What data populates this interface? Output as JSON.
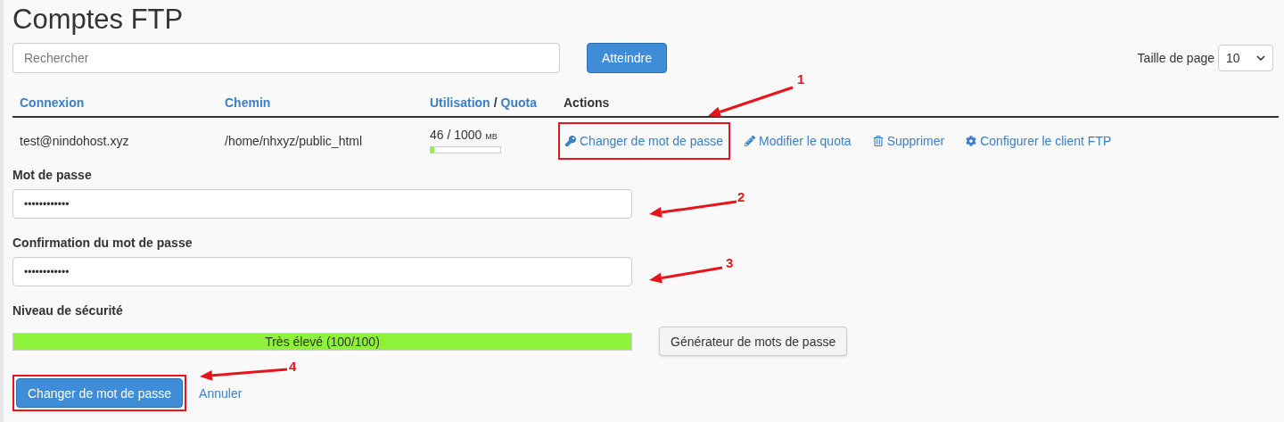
{
  "title": "Comptes FTP",
  "search": {
    "placeholder": "Rechercher"
  },
  "go_button": "Atteindre",
  "page_size": {
    "label": "Taille de page",
    "value": "10"
  },
  "table": {
    "headers": [
      {
        "kind": "link",
        "label": "Connexion"
      },
      {
        "kind": "link",
        "label": "Chemin"
      },
      {
        "kind": "pair",
        "label": "Utilisation",
        "separator": "/",
        "label2": "Quota"
      },
      {
        "kind": "plain",
        "label": "Actions"
      }
    ],
    "rows": [
      {
        "login": "test@nindohost.xyz",
        "path": "/home/nhxyz/public_html",
        "usage": "46 / 1000",
        "unit": "MB",
        "level": 0.046,
        "actions": [
          {
            "kind": "key",
            "label": "Changer de mot de passe",
            "highlighted": true
          },
          {
            "kind": "pencil",
            "label": "Modifier le quota",
            "highlighted": false
          },
          {
            "kind": "trash",
            "label": "Supprimer",
            "highlighted": false
          },
          {
            "kind": "gear",
            "label": "Configurer le client FTP",
            "highlighted": false
          }
        ]
      }
    ]
  },
  "password": {
    "label": "Mot de passe",
    "value": "••••••••••••"
  },
  "confirm": {
    "label": "Confirmation du mot de passe",
    "value": "••••••••••••"
  },
  "strength": {
    "label": "Niveau de sécurité",
    "reading": "Très élevé (100/100)",
    "level": 1.0,
    "color": "#8ff23a"
  },
  "generator_button": "Générateur de mots de passe",
  "submit": {
    "label": "Changer de mot de passe",
    "highlighted": true
  },
  "cancel": "Annuler",
  "annotations": [
    {
      "label": "1"
    },
    {
      "label": "2"
    },
    {
      "label": "3"
    },
    {
      "label": "4"
    }
  ]
}
